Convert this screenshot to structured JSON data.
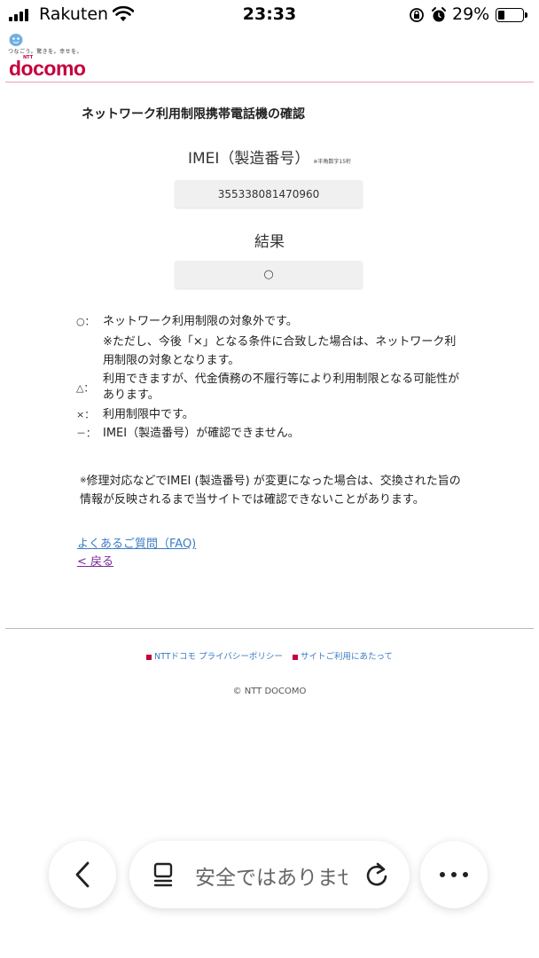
{
  "status_bar": {
    "carrier": "Rakuten",
    "time": "23:33",
    "battery_percent": "29%",
    "battery_level": 0.29,
    "icons": [
      "signal-icon",
      "wifi-icon",
      "orientation-lock-icon",
      "alarm-icon",
      "battery-icon"
    ]
  },
  "header": {
    "tagline": "つなごう。驚きを。幸せを。",
    "ntt": "NTT",
    "logo": "docomo",
    "brand_color": "#c5003e"
  },
  "page": {
    "title": "ネットワーク利用制限携帯電話機の確認"
  },
  "imei": {
    "label": "IMEI（製造番号）",
    "note": "※半角数字15桁",
    "value": "355338081470960"
  },
  "result": {
    "label": "結果",
    "value": "○"
  },
  "legend": {
    "circle_symbol": "○：",
    "circle_text": "ネットワーク利用制限の対象外です。",
    "circle_sub": "※ただし、今後「×」となる条件に合致した場合は、ネットワーク利用制限の対象となります。",
    "triangle_symbol": "△：",
    "triangle_text": "利用できますが、代金債務の不履行等により利用制限となる可能性があります。",
    "cross_symbol": "×：",
    "cross_text": "利用制限中です。",
    "dash_symbol": "－：",
    "dash_text": "IMEI（製造番号）が確認できません。"
  },
  "repair_note": {
    "asterisk": "※",
    "text": "修理対応などでIMEI (製造番号) が変更になった場合は、交換された旨の情報が反映されるまで当サイトでは確認できないことがあります。"
  },
  "links": {
    "faq": "よくあるご質問（FAQ)",
    "back": "< 戻る"
  },
  "footer": {
    "privacy": "NTTドコモ プライバシーポリシー",
    "terms": "サイトご利用にあたって",
    "copyright": "© NTT DOCOMO"
  },
  "browser_toolbar": {
    "address_text": "安全ではありません ip",
    "icons": [
      "back-icon",
      "tabs-icon",
      "reload-icon",
      "more-icon"
    ]
  }
}
